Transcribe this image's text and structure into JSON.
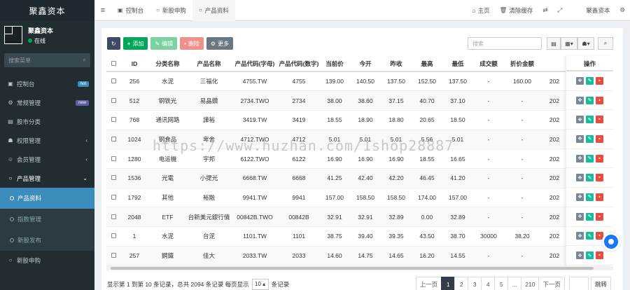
{
  "sidebar": {
    "brand": "聚鑫资本",
    "user_name": "聚鑫资本",
    "user_status": "在线",
    "search_placeholder": "搜索菜单",
    "items": [
      {
        "label": "控制台",
        "icon": "▣",
        "badge": "hot",
        "badge_color": "#3c8dbc"
      },
      {
        "label": "常规管理",
        "icon": "⚙",
        "badge": "new",
        "badge_color": "#605ca8"
      },
      {
        "label": "股市分类",
        "icon": "▤"
      },
      {
        "label": "权限管理",
        "icon": "☗",
        "chev": "‹"
      },
      {
        "label": "会员管理",
        "icon": "☺",
        "chev": "‹"
      },
      {
        "label": "产品管理",
        "icon": "○",
        "chev": "⌄"
      }
    ],
    "sub_items": [
      {
        "label": "产品资料"
      },
      {
        "label": "指数管理"
      },
      {
        "label": "新股发布"
      }
    ],
    "bottom_items": [
      {
        "label": "新股申购"
      }
    ]
  },
  "topbar": {
    "tabs": [
      {
        "label": "控制台",
        "icon": "▣"
      },
      {
        "label": "新股申购",
        "icon": "○"
      },
      {
        "label": "产品资料",
        "icon": "○"
      }
    ],
    "home": "主页",
    "clear_cache": "清除缓存",
    "user": "聚鑫资本"
  },
  "toolbar": {
    "add": "添加",
    "edit": "编辑",
    "delete": "删除",
    "more": "更多",
    "search_placeholder": "搜索"
  },
  "table": {
    "columns": [
      "ID",
      "分类名称",
      "产品名称",
      "产品代码(字母)",
      "产品代码(数字)",
      "当前价",
      "今开",
      "昨收",
      "最高",
      "最低",
      "成交额",
      "折价金额",
      ""
    ],
    "ops_header": "操作",
    "rows": [
      [
        "256",
        "水泥",
        "三福化",
        "4755.TW",
        "4755",
        "139.00",
        "140.50",
        "137.50",
        "152.50",
        "137.50",
        "-",
        "160.00",
        "202"
      ],
      [
        "512",
        "钢铁光",
        "易晶鑽",
        "2734.TWO",
        "2734",
        "38.00",
        "38.60",
        "37.15",
        "40.70",
        "37.10",
        "-",
        "-",
        "202"
      ],
      [
        "768",
        "通讯网路",
        "譁裕",
        "3419.TW",
        "3419",
        "18.55",
        "18.90",
        "18.80",
        "20.65",
        "18.50",
        "-",
        "-",
        "202"
      ],
      [
        "1024",
        "钢食品",
        "卑舍",
        "4712.TWO",
        "4712",
        "5.01",
        "5.01",
        "5.01",
        "5.56",
        "5.01",
        "-",
        "-",
        "202"
      ],
      [
        "1280",
        "电运機",
        "宇邦",
        "6122.TWO",
        "6122",
        "16.90",
        "16.90",
        "16.90",
        "18.55",
        "16.65",
        "-",
        "-",
        "202"
      ],
      [
        "1536",
        "光電",
        "小提光",
        "6668.TW",
        "6668",
        "41.25",
        "42.40",
        "42.20",
        "46.45",
        "41.20",
        "-",
        "-",
        "202"
      ],
      [
        "1792",
        "其他",
        "裕融",
        "9941.TW",
        "9941",
        "157.00",
        "158.50",
        "158.50",
        "174.00",
        "157.00",
        "-",
        "-",
        "202"
      ],
      [
        "2048",
        "ETF",
        "台新美元銀行債",
        "00842B.TWO",
        "00842B",
        "32.91",
        "32.91",
        "32.89",
        "0.00",
        "32.89",
        "-",
        "-",
        "202"
      ],
      [
        "1",
        "水泥",
        "台泥",
        "1101.TW",
        "1101",
        "38.75",
        "39.40",
        "39.35",
        "43.50",
        "38.70",
        "30000",
        "38.20",
        "202"
      ],
      [
        "257",
        "鋼鐵",
        "佳大",
        "2033.TW",
        "2033",
        "14.60",
        "14.75",
        "14.65",
        "16.20",
        "14.55",
        "-",
        "-",
        "202"
      ]
    ]
  },
  "footer": {
    "text_before": "显示第 1 到第 10 条记录，总共 2094 条记录 每页显示",
    "page_size": "10 ▴",
    "text_after": "条记录",
    "prev": "上一页",
    "pages": [
      "1",
      "2",
      "3",
      "4",
      "5",
      "...",
      "210"
    ],
    "next": "下一页",
    "jump": "跳转"
  },
  "watermark": "https://www.huzhan.com/1shop28887",
  "colors": {
    "add": "#00a65a",
    "edit": "#7bd1a0",
    "delete": "#f0908a",
    "more": "#6a7781",
    "refresh": "#3c4b63",
    "op_drag": "#7a8694",
    "op_edit": "#18bc9c",
    "op_del": "#e74c3c"
  }
}
